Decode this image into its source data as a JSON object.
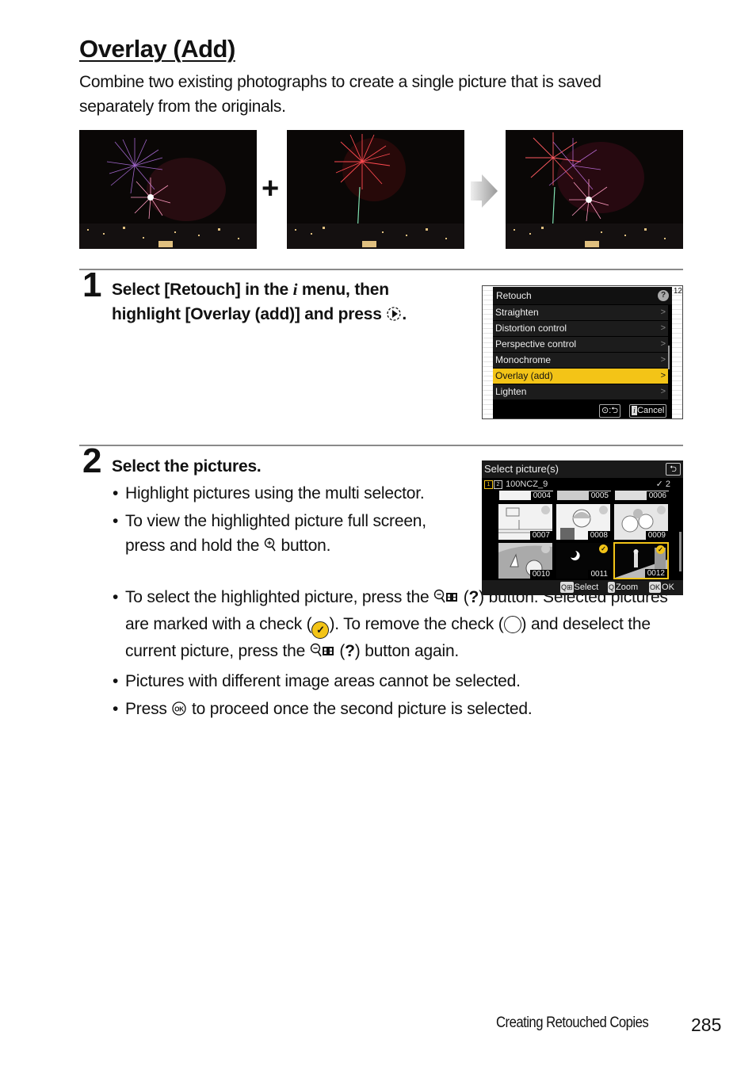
{
  "title": "Overlay (Add)",
  "intro": "Combine two existing photographs to create a single picture that is saved separately from the originals.",
  "photos": [
    {
      "label": "first-source-photo",
      "description": "fireworks purple and pink over city"
    },
    {
      "label": "second-source-photo",
      "description": "red firework with green trail over city"
    },
    {
      "label": "result-photo",
      "description": "combined overlay of both fireworks"
    }
  ],
  "operators": {
    "plus": "+",
    "arrow": "result-arrow"
  },
  "step1": {
    "number": "1",
    "line1_a": "Select [Retouch] in the ",
    "line1_icon": "i",
    "line1_b": " menu, then",
    "line2_a": "highlight [Overlay (add)] and press ",
    "line2_b": "."
  },
  "retouch_screen": {
    "header": "Retouch",
    "help": "?",
    "page_indicator": "12",
    "items": [
      {
        "label": "Straighten",
        "selected": false
      },
      {
        "label": "Distortion control",
        "selected": false
      },
      {
        "label": "Perspective control",
        "selected": false
      },
      {
        "label": "Monochrome",
        "selected": false
      },
      {
        "label": "Overlay (add)",
        "selected": true
      },
      {
        "label": "Lighten",
        "selected": false
      }
    ],
    "chevron": ">",
    "footer_back": "⊙:⮌",
    "footer_cancel_icon": "i",
    "footer_cancel": "Cancel",
    "highlight_color": "#f3c417"
  },
  "step2": {
    "number": "2",
    "heading": "Select the pictures.",
    "bullets": {
      "b1": "Highlight pictures using the multi selector.",
      "b2_a": "To view the highlighted picture full screen, press and hold the ",
      "b2_b": " button.",
      "b3_a": "To select the highlighted picture, press the ",
      "b3_b": " (",
      "b3_q": "?",
      "b3_c": ") button. Selected pictures are marked with a check (",
      "b3_d": "). To remove the check (",
      "b3_e": ") and deselect the current picture, press the ",
      "b3_f": " (",
      "b3_g": ") button again.",
      "b4": "Pictures with different image areas cannot be selected.",
      "b5_a": "Press ",
      "b5_b": " to proceed once the second picture is selected."
    }
  },
  "select_screen": {
    "header": "Select picture(s)",
    "back": "⮌",
    "slot1": "1",
    "slot2": "2",
    "folder": "100NCZ_9",
    "selected_count": "✓ 2",
    "partial_row": [
      "0004",
      "0005",
      "0006"
    ],
    "thumbs": [
      {
        "num": "0007",
        "checked": false
      },
      {
        "num": "0008",
        "checked": false
      },
      {
        "num": "0009",
        "checked": false
      },
      {
        "num": "0010",
        "checked": false
      },
      {
        "num": "0011",
        "checked": true
      },
      {
        "num": "0012",
        "checked": true,
        "highlighted": true
      }
    ],
    "footer_select": "Select",
    "footer_zoom": "Zoom",
    "footer_ok_icon": "OK",
    "footer_ok": "OK"
  },
  "footer": {
    "section": "Creating Retouched Copies",
    "page": "285"
  }
}
